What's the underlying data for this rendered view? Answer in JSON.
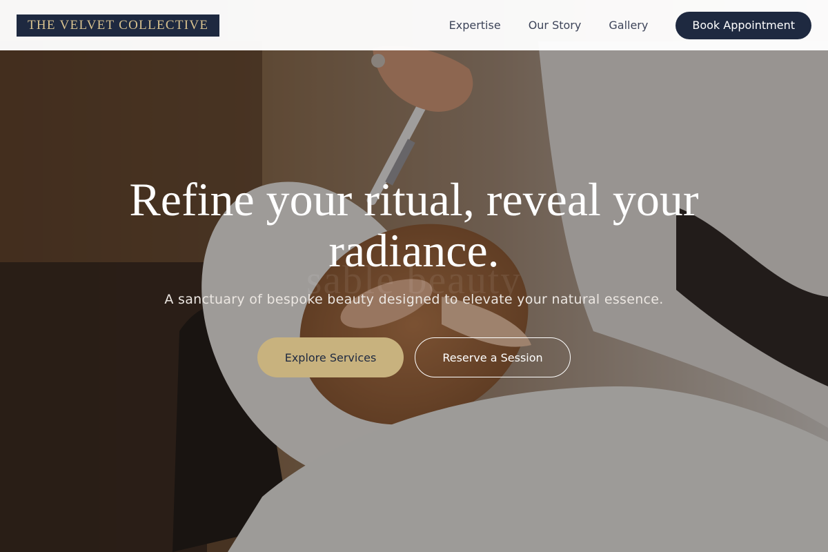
{
  "brand": {
    "name": "THE VELVET COLLECTIVE",
    "colors": {
      "navy": "#1e2940",
      "gold": "#c8b27e",
      "gold_text": "#d9c38f"
    }
  },
  "nav": {
    "links": [
      {
        "label": "Expertise"
      },
      {
        "label": "Our Story"
      },
      {
        "label": "Gallery"
      }
    ],
    "cta_label": "Book Appointment"
  },
  "hero": {
    "headline": "Refine your ritual, reveal your radiance.",
    "watermark": "sable beauty",
    "subheading": "A sanctuary of bespoke beauty designed to elevate your natural essence.",
    "primary_cta": "Explore Services",
    "secondary_cta": "Reserve a Session",
    "background_image": "facial-treatment-photo"
  }
}
